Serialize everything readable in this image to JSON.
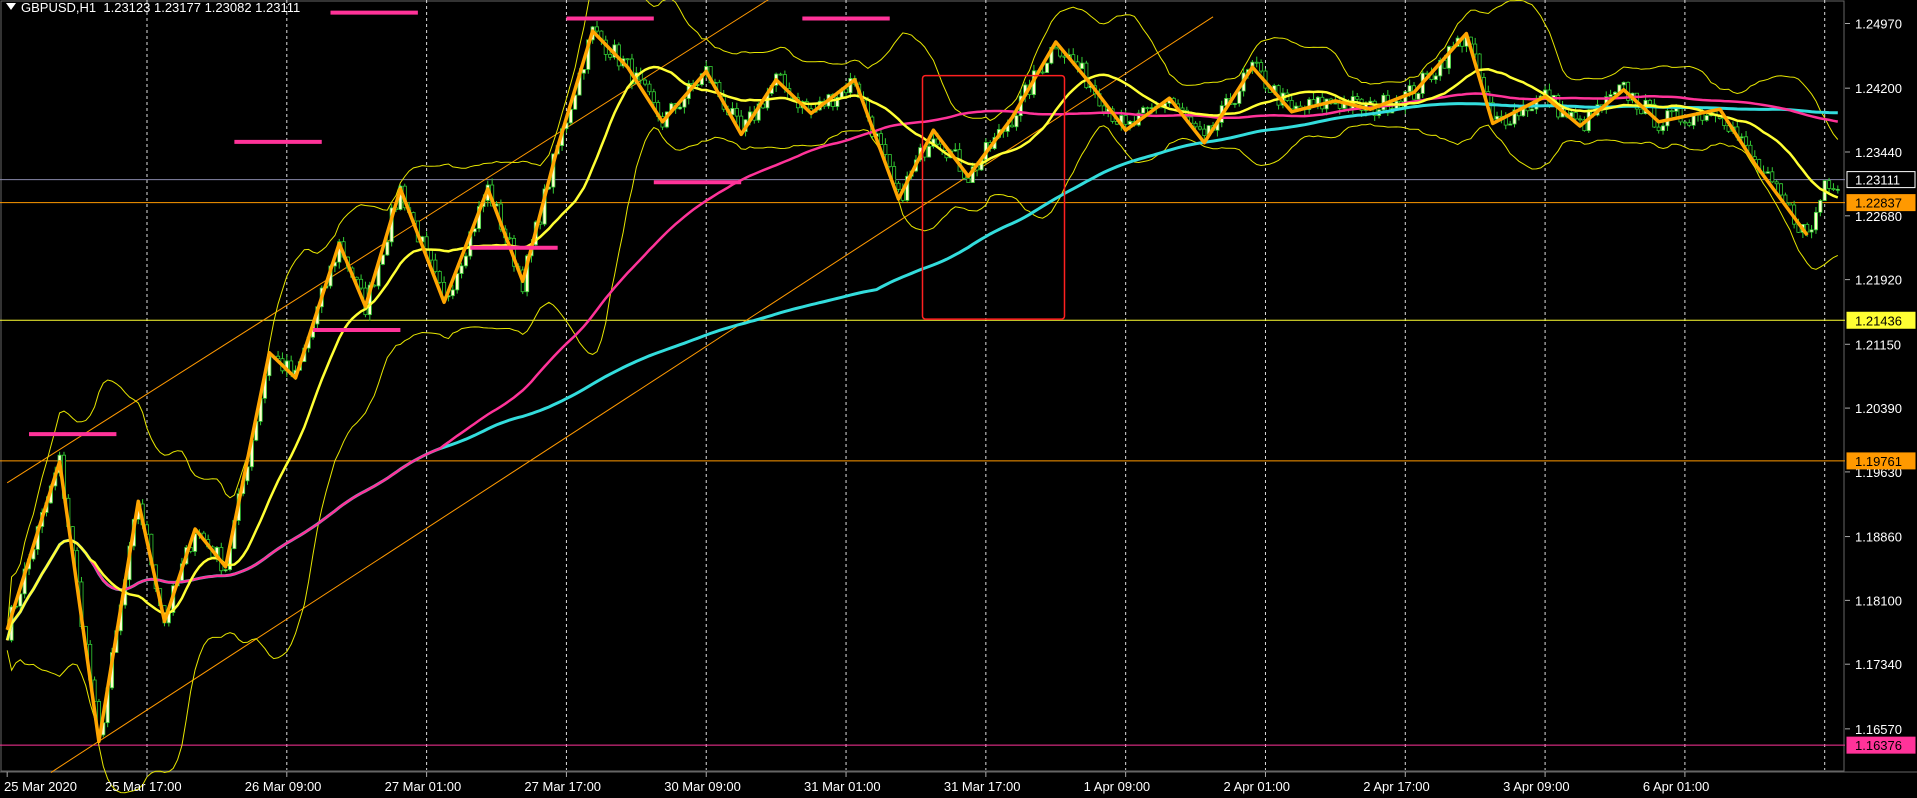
{
  "header": {
    "symbol": "GBPUSD,H1",
    "ohlc": "1.23123 1.23177 1.23082 1.23111"
  },
  "colors": {
    "background": "#000000",
    "candle_up": "#ffffcc",
    "candle_down": "#000000",
    "wick": "#33cc33",
    "ma_fast": "#ffff33",
    "ma_mid": "#ff3399",
    "ma_slow": "#33dddd",
    "zigzag": "#ffa500",
    "bands": "#e6e600",
    "pink_level": "#ff3399",
    "box": "#ff2020",
    "trendline": "#ff9900"
  },
  "chart_data": {
    "type": "candlestick",
    "symbol": "GBPUSD",
    "timeframe": "H1",
    "ylim": [
      1.1608,
      1.2525
    ],
    "x_tick_labels": [
      "25 Mar 2020",
      "25 Mar 17:00",
      "26 Mar 09:00",
      "27 Mar 01:00",
      "27 Mar 17:00",
      "30 Mar 09:00",
      "31 Mar 01:00",
      "31 Mar 17:00",
      "1 Apr 09:00",
      "2 Apr 01:00",
      "2 Apr 17:00",
      "3 Apr 09:00",
      "6 Apr 01:00"
    ],
    "y_tick_labels": [
      "1.24970",
      "1.24200",
      "1.23440",
      "1.22680",
      "1.21920",
      "1.21150",
      "1.20390",
      "1.19630",
      "1.18860",
      "1.18100",
      "1.17340",
      "1.16570"
    ],
    "y_tick_values": [
      1.2497,
      1.242,
      1.2344,
      1.2268,
      1.2192,
      1.2115,
      1.2039,
      1.1963,
      1.1886,
      1.181,
      1.1734,
      1.1657
    ],
    "price_tags": [
      {
        "label": "1.23111",
        "value": 1.23111,
        "style": "current"
      },
      {
        "label": "1.22837",
        "value": 1.22837,
        "style": "orange"
      },
      {
        "label": "1.21436",
        "value": 1.21436,
        "style": "yellow"
      },
      {
        "label": "1.19761",
        "value": 1.19761,
        "style": "orange"
      },
      {
        "label": "1.16376",
        "value": 1.16376,
        "style": "pink"
      }
    ],
    "zigzag": [
      [
        0,
        1.1775
      ],
      [
        12,
        1.1975
      ],
      [
        21,
        1.1642
      ],
      [
        30,
        1.1928
      ],
      [
        36,
        1.1785
      ],
      [
        43,
        1.1895
      ],
      [
        50,
        1.185
      ],
      [
        60,
        1.2105
      ],
      [
        66,
        1.2075
      ],
      [
        76,
        1.2235
      ],
      [
        82,
        1.216
      ],
      [
        90,
        1.23
      ],
      [
        100,
        1.2165
      ],
      [
        110,
        1.23
      ],
      [
        118,
        1.219
      ],
      [
        126,
        1.235
      ],
      [
        134,
        1.2488
      ],
      [
        142,
        1.2445
      ],
      [
        150,
        1.238
      ],
      [
        160,
        1.244
      ],
      [
        168,
        1.2365
      ],
      [
        176,
        1.243
      ],
      [
        184,
        1.239
      ],
      [
        194,
        1.243
      ],
      [
        204,
        1.2288
      ],
      [
        212,
        1.237
      ],
      [
        220,
        1.2315
      ],
      [
        230,
        1.2385
      ],
      [
        240,
        1.2475
      ],
      [
        248,
        1.2425
      ],
      [
        256,
        1.237
      ],
      [
        266,
        1.2408
      ],
      [
        274,
        1.2355
      ],
      [
        285,
        1.2445
      ],
      [
        294,
        1.2392
      ],
      [
        304,
        1.2405
      ],
      [
        312,
        1.2395
      ],
      [
        322,
        1.2415
      ],
      [
        334,
        1.2485
      ],
      [
        340,
        1.2378
      ],
      [
        352,
        1.241
      ],
      [
        360,
        1.2375
      ],
      [
        370,
        1.2418
      ],
      [
        378,
        1.238
      ],
      [
        392,
        1.2395
      ],
      [
        400,
        1.233
      ],
      [
        412,
        1.2245
      ]
    ],
    "resistance_levels": [
      {
        "x1": 5,
        "x2": 25,
        "y": 1.2008
      },
      {
        "x1": 52,
        "x2": 72,
        "y": 1.2356
      },
      {
        "x1": 70,
        "x2": 90,
        "y": 1.2132
      },
      {
        "x1": 74,
        "x2": 94,
        "y": 1.251
      },
      {
        "x1": 106,
        "x2": 126,
        "y": 1.223
      },
      {
        "x1": 128,
        "x2": 148,
        "y": 1.2503
      },
      {
        "x1": 148,
        "x2": 168,
        "y": 1.2308
      },
      {
        "x1": 182,
        "x2": 202,
        "y": 1.2503
      }
    ],
    "horizontal_lines": [
      {
        "y": 1.23111,
        "color": "#8888aa"
      },
      {
        "y": 1.22837,
        "color": "#ff9900"
      },
      {
        "y": 1.21436,
        "color": "#ffff33"
      },
      {
        "y": 1.19761,
        "color": "#ff9900"
      },
      {
        "y": 1.16376,
        "color": "#ff3399"
      }
    ],
    "trendlines": [
      {
        "x1": 0,
        "x2": 175,
        "y1": 1.195,
        "y2": 1.2528
      },
      {
        "x1": 10,
        "x2": 276,
        "y1": 1.1605,
        "y2": 1.2505
      }
    ],
    "highlight_box": {
      "x1": 209.5,
      "x2": 242,
      "y_top": 1.2435,
      "y_bottom": 1.2145
    },
    "series": [
      {
        "kind": "candles"
      },
      {
        "kind": "ma",
        "period": "fast"
      },
      {
        "kind": "ma",
        "period": "mid"
      },
      {
        "kind": "ma",
        "period": "slow"
      },
      {
        "kind": "bollinger"
      },
      {
        "kind": "zigzag"
      }
    ]
  }
}
